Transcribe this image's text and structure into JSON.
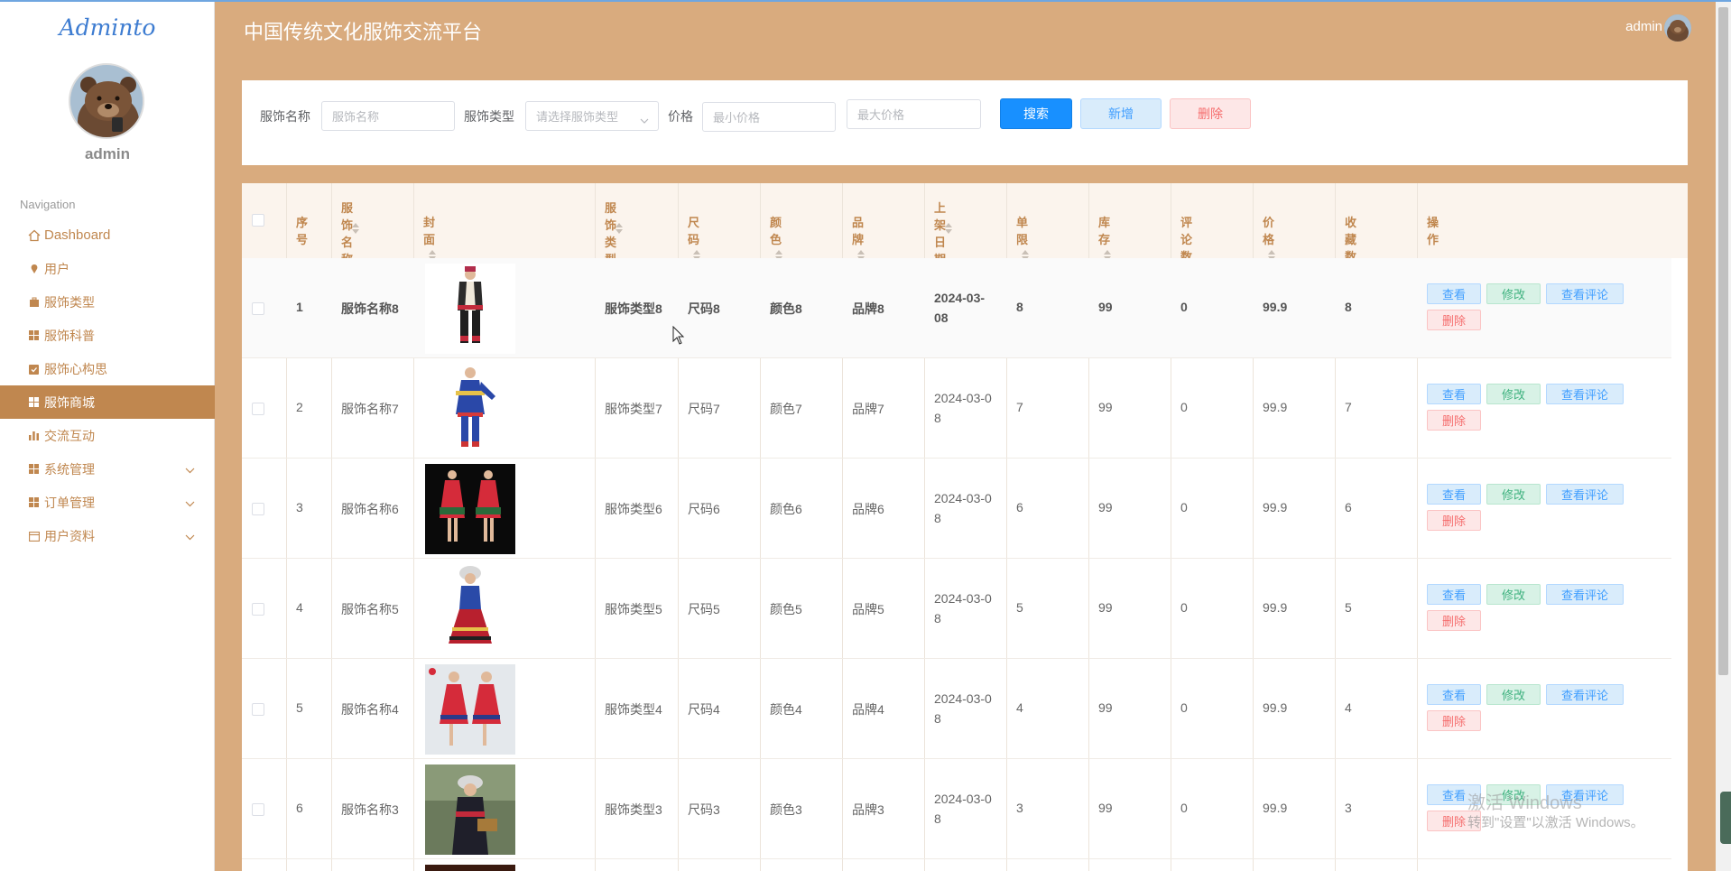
{
  "app": {
    "title": "中国传统文化服饰交流平台",
    "logo": "Adminto",
    "user": "admin"
  },
  "sidebar": {
    "username": "admin",
    "nav_title": "Navigation",
    "items": [
      {
        "label": "Dashboard",
        "icon": "home-icon"
      },
      {
        "label": "用户",
        "icon": "user-icon"
      },
      {
        "label": "服饰类型",
        "icon": "briefcase-icon"
      },
      {
        "label": "服饰科普",
        "icon": "grid-icon"
      },
      {
        "label": "服饰心构思",
        "icon": "clipboard-icon"
      },
      {
        "label": "服饰商城",
        "icon": "grid-icon",
        "active": true
      },
      {
        "label": "交流互动",
        "icon": "bar-chart-icon"
      },
      {
        "label": "系统管理",
        "icon": "grid-icon",
        "expandable": true
      },
      {
        "label": "订单管理",
        "icon": "grid-icon",
        "expandable": true
      },
      {
        "label": "用户资料",
        "icon": "calendar-icon",
        "expandable": true
      }
    ]
  },
  "search": {
    "name_label": "服饰名称",
    "name_placeholder": "服饰名称",
    "type_label": "服饰类型",
    "type_placeholder": "请选择服饰类型",
    "price_label": "价格",
    "min_price_placeholder": "最小价格",
    "max_price_placeholder": "最大价格",
    "search_btn": "搜索",
    "add_btn": "新增",
    "delete_btn": "删除"
  },
  "table": {
    "headers": {
      "index": "序号",
      "name": "服饰名称",
      "cover": "封面",
      "type": "服饰类型",
      "size": "尺码",
      "color": "颜色",
      "brand": "品牌",
      "date": "上架日期",
      "limit": "单限",
      "stock": "库存",
      "reviews": "评论数",
      "price": "价格",
      "favorites": "收藏数",
      "actions": "操作"
    },
    "actions": {
      "view": "查看",
      "edit": "修改",
      "comments": "查看评论",
      "delete": "删除"
    },
    "rows": [
      {
        "index": "1",
        "name": "服饰名称8",
        "type": "服饰类型8",
        "size": "尺码8",
        "color": "颜色8",
        "brand": "品牌8",
        "date_a": "2024-03-",
        "date_b": "08",
        "limit": "8",
        "stock": "99",
        "reviews": "0",
        "price": "99.9",
        "favorites": "8"
      },
      {
        "index": "2",
        "name": "服饰名称7",
        "type": "服饰类型7",
        "size": "尺码7",
        "color": "颜色7",
        "brand": "品牌7",
        "date_a": "2024-03-0",
        "date_b": "8",
        "limit": "7",
        "stock": "99",
        "reviews": "0",
        "price": "99.9",
        "favorites": "7"
      },
      {
        "index": "3",
        "name": "服饰名称6",
        "type": "服饰类型6",
        "size": "尺码6",
        "color": "颜色6",
        "brand": "品牌6",
        "date_a": "2024-03-0",
        "date_b": "8",
        "limit": "6",
        "stock": "99",
        "reviews": "0",
        "price": "99.9",
        "favorites": "6"
      },
      {
        "index": "4",
        "name": "服饰名称5",
        "type": "服饰类型5",
        "size": "尺码5",
        "color": "颜色5",
        "brand": "品牌5",
        "date_a": "2024-03-0",
        "date_b": "8",
        "limit": "5",
        "stock": "99",
        "reviews": "0",
        "price": "99.9",
        "favorites": "5"
      },
      {
        "index": "5",
        "name": "服饰名称4",
        "type": "服饰类型4",
        "size": "尺码4",
        "color": "颜色4",
        "brand": "品牌4",
        "date_a": "2024-03-0",
        "date_b": "8",
        "limit": "4",
        "stock": "99",
        "reviews": "0",
        "price": "99.9",
        "favorites": "4"
      },
      {
        "index": "6",
        "name": "服饰名称3",
        "type": "服饰类型3",
        "size": "尺码3",
        "color": "颜色3",
        "brand": "品牌3",
        "date_a": "2024-03-0",
        "date_b": "8",
        "limit": "3",
        "stock": "99",
        "reviews": "0",
        "price": "99.9",
        "favorites": "3"
      }
    ]
  },
  "watermark": {
    "line1": "激活 Windows",
    "line2": "转到\"设置\"以激活 Windows。"
  },
  "colors": {
    "accent": "#c0874f",
    "background": "#d9ab7e",
    "primary": "#1890ff"
  }
}
